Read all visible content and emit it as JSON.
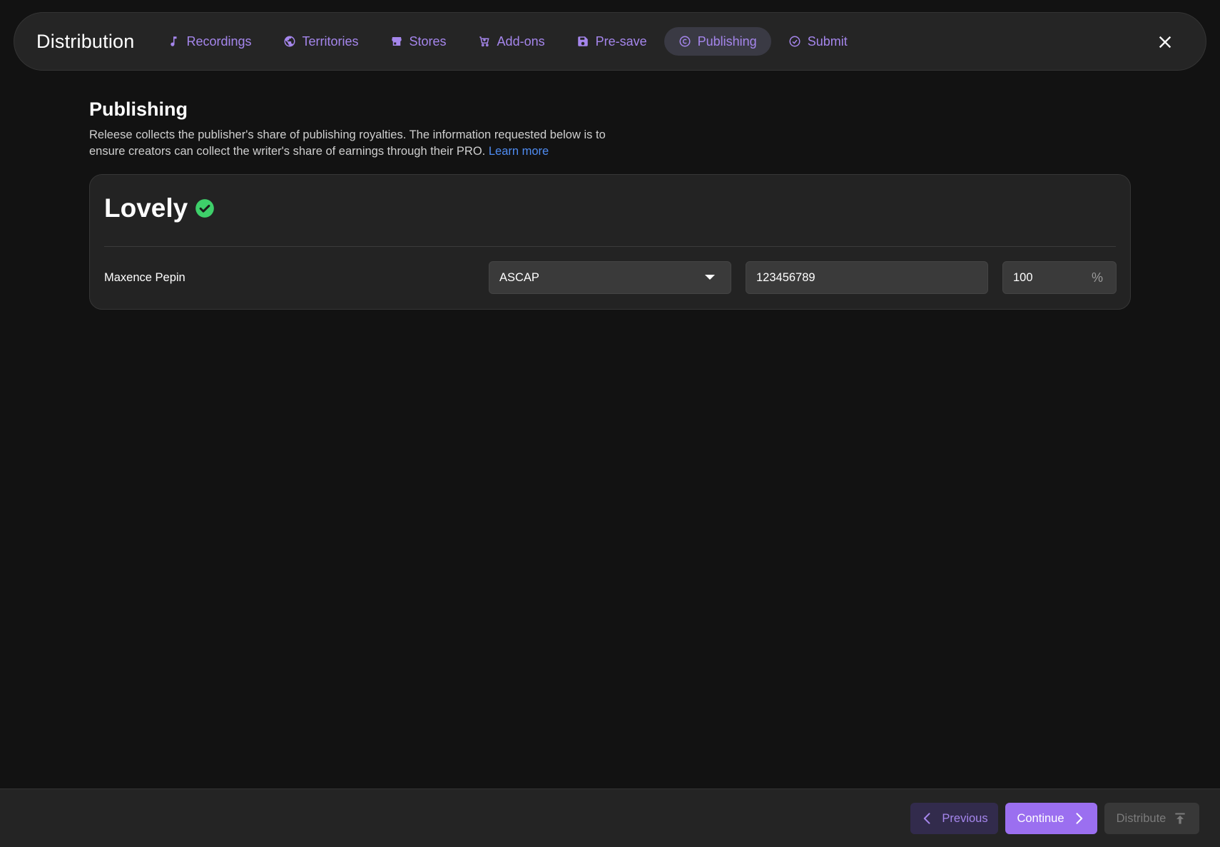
{
  "header": {
    "title": "Distribution",
    "tabs": [
      {
        "label": "Recordings",
        "icon": "music-note-icon"
      },
      {
        "label": "Territories",
        "icon": "globe-icon"
      },
      {
        "label": "Stores",
        "icon": "store-icon"
      },
      {
        "label": "Add-ons",
        "icon": "cart-icon"
      },
      {
        "label": "Pre-save",
        "icon": "save-icon"
      },
      {
        "label": "Publishing",
        "icon": "copyright-icon",
        "active": true
      },
      {
        "label": "Submit",
        "icon": "check-circle-icon"
      }
    ],
    "close_icon": "close-icon"
  },
  "section": {
    "title": "Publishing",
    "description": "Releese collects the publisher's share of publishing royalties. The information requested below is to ensure creators can collect the writer's share of earnings through their PRO.",
    "learn_more": "Learn more"
  },
  "track": {
    "title": "Lovely",
    "status_icon": "verified-check-icon",
    "writers": [
      {
        "name": "Maxence Pepin",
        "pro": "ASCAP",
        "ipi": "123456789",
        "share": "100",
        "share_unit": "%"
      }
    ]
  },
  "footer": {
    "previous_label": "Previous",
    "continue_label": "Continue",
    "distribute_label": "Distribute"
  },
  "colors": {
    "background": "#121212",
    "accent": "#a586ec",
    "primary_button": "#9b6ff0",
    "link": "#4f8cf2",
    "success": "#3ecf6a"
  }
}
